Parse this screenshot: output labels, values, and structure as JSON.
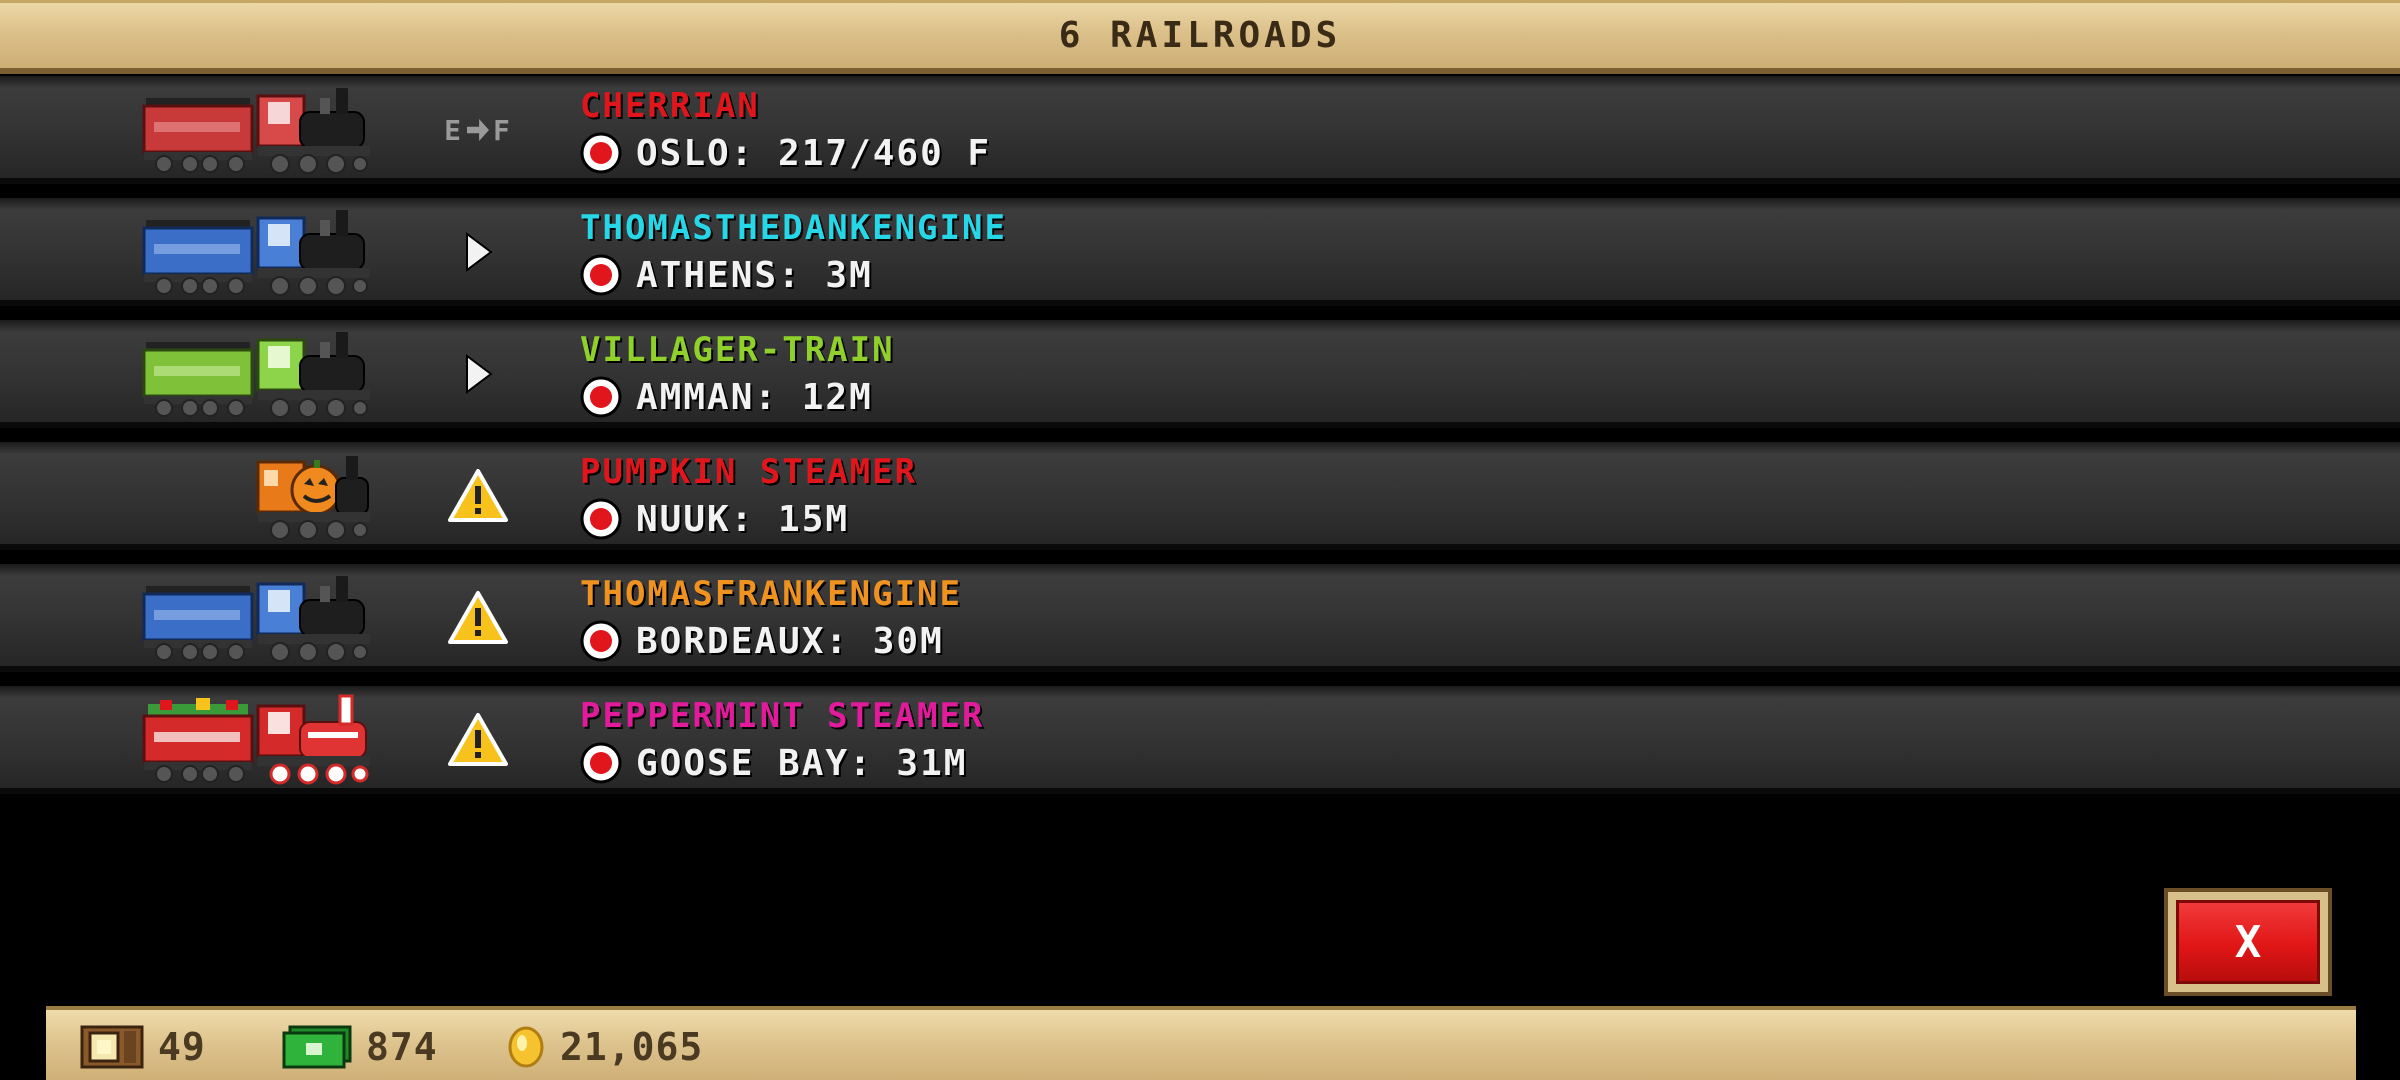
{
  "header": {
    "title": "6 RAILROADS"
  },
  "railroads": [
    {
      "name": "CHERRIAN",
      "name_color": "#e0161c",
      "destination": "OSLO: 217/460 F",
      "status_icon": "loading-indicator",
      "status_text": "E",
      "status_text2": "F",
      "train": "red-locomotive-with-tender"
    },
    {
      "name": "THOMASTHEDANKENGINE",
      "name_color": "#26d7e8",
      "destination": "ATHENS: 3M",
      "status_icon": "play-arrow-icon",
      "train": "blue-locomotive-with-tender"
    },
    {
      "name": "VILLAGER-TRAIN",
      "name_color": "#8fd12a",
      "destination": "AMMAN: 12M",
      "status_icon": "play-arrow-icon",
      "train": "green-locomotive-with-tender"
    },
    {
      "name": "PUMPKIN STEAMER",
      "name_color": "#e0161c",
      "destination": "NUUK: 15M",
      "status_icon": "warning-icon",
      "train": "pumpkin-locomotive"
    },
    {
      "name": "THOMASFRANKENGINE",
      "name_color": "#f0921f",
      "destination": "BORDEAUX: 30M",
      "status_icon": "warning-icon",
      "train": "blue-locomotive-with-tender"
    },
    {
      "name": "PEPPERMINT STEAMER",
      "name_color": "#e21b9c",
      "destination": "GOOSE BAY: 31M",
      "status_icon": "warning-icon",
      "train": "peppermint-locomotive-with-tender"
    }
  ],
  "close_button": {
    "label": "X"
  },
  "resources": {
    "crates": "49",
    "cash": "874",
    "coins": "21,065"
  },
  "colors": {
    "frame_tan": "#dcc08a",
    "row_dark": "#333333",
    "warning_yellow": "#f7c21b",
    "close_red": "#e01616"
  }
}
